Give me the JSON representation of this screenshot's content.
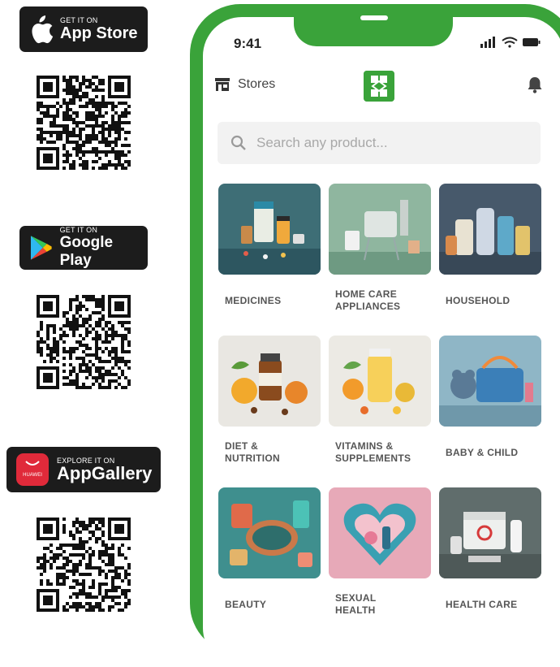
{
  "badges": {
    "app_store": {
      "small": "GET IT ON",
      "big": "App Store"
    },
    "google_play": {
      "small": "GET IT ON",
      "big": "Google Play"
    },
    "app_gallery": {
      "small": "EXPLORE IT ON",
      "big": "AppGallery",
      "logo_text": "HUAWEI"
    }
  },
  "phone": {
    "time": "9:41",
    "stores_label": "Stores",
    "search_placeholder": "Search any product...",
    "categories": [
      {
        "line1": "MEDICINES",
        "line2": ""
      },
      {
        "line1": "HOME CARE",
        "line2": "APPLIANCES"
      },
      {
        "line1": "HOUSEHOLD",
        "line2": ""
      },
      {
        "line1": "DIET &",
        "line2": "NUTRITION"
      },
      {
        "line1": "VITAMINS &",
        "line2": "SUPPLEMENTS"
      },
      {
        "line1": "BABY & CHILD",
        "line2": ""
      },
      {
        "line1": "BEAUTY",
        "line2": ""
      },
      {
        "line1": "SEXUAL",
        "line2": "HEALTH"
      },
      {
        "line1": "HEALTH CARE",
        "line2": ""
      }
    ]
  },
  "colors": {
    "brand_green": "#3aa33a",
    "badge_black": "#1c1c1c",
    "huawei_red": "#e02a3a"
  },
  "icons": [
    "apple-logo-icon",
    "google-play-icon",
    "huawei-logo-icon",
    "qr-code-icon",
    "store-icon",
    "pharmacy-logo-icon",
    "bell-icon",
    "search-icon",
    "signal-icon",
    "wifi-icon",
    "battery-icon"
  ]
}
